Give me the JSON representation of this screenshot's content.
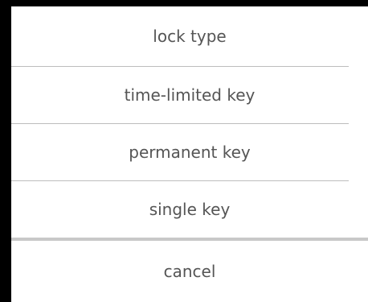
{
  "action_sheet": {
    "title": "lock type",
    "options": [
      {
        "label": "time-limited key"
      },
      {
        "label": "permanent key"
      },
      {
        "label": "single key"
      }
    ],
    "cancel_label": "cancel"
  }
}
